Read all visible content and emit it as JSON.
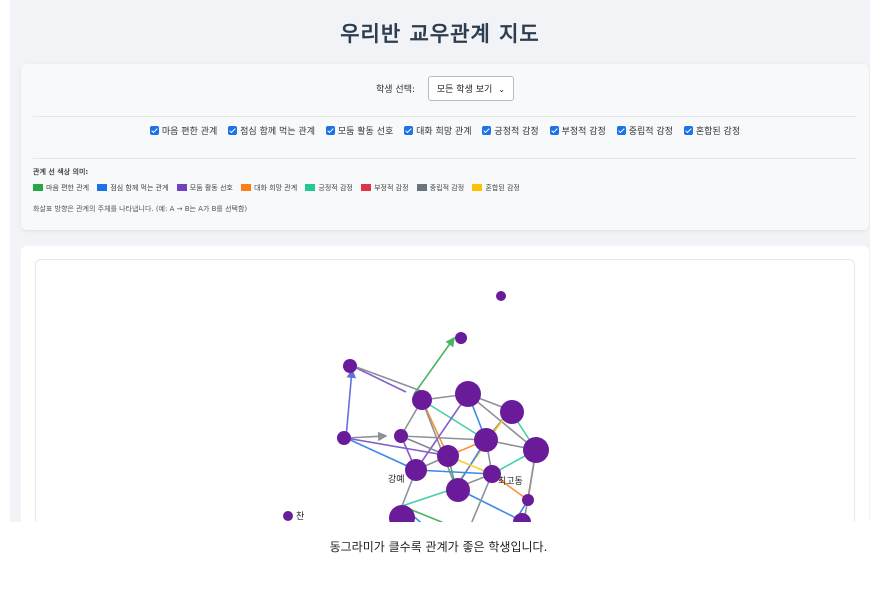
{
  "page": {
    "title": "우리반 교우관계 지도"
  },
  "selector": {
    "label": "학생 선택:",
    "value": "모든 학생 보기"
  },
  "filters": [
    {
      "label": "마음 편한 관계",
      "checked": true
    },
    {
      "label": "점심 함께 먹는 관계",
      "checked": true
    },
    {
      "label": "모둠 활동 선호",
      "checked": true
    },
    {
      "label": "대화 희망 관계",
      "checked": true
    },
    {
      "label": "긍정적 감정",
      "checked": true
    },
    {
      "label": "부정적 감정",
      "checked": true
    },
    {
      "label": "중립적 감정",
      "checked": true
    },
    {
      "label": "혼합된 감정",
      "checked": true
    }
  ],
  "legend": {
    "title": "관계 선 색상 의미:",
    "items": [
      {
        "label": "마음 편한 관계",
        "color": "#28a745"
      },
      {
        "label": "점심 함께 먹는 관계",
        "color": "#1a73e8"
      },
      {
        "label": "모둠 활동 선호",
        "color": "#6f42c1"
      },
      {
        "label": "대화 희망 관계",
        "color": "#fd7e14"
      },
      {
        "label": "긍정적 감정",
        "color": "#20c997"
      },
      {
        "label": "부정적 감정",
        "color": "#dc3545"
      },
      {
        "label": "중립적 감정",
        "color": "#6c757d"
      },
      {
        "label": "혼합된 감정",
        "color": "#ffc107"
      }
    ],
    "note": "화살표 방향은 관계의 주체를 나타냅니다. (예: A → B는 A가 B를 선택함)"
  },
  "graph": {
    "node_color": "#6a1b9a",
    "node_labels": [
      "강예",
      "최고동",
      "찬"
    ]
  },
  "caption": "동그라미가 클수록 관계가 좋은 학생입니다."
}
